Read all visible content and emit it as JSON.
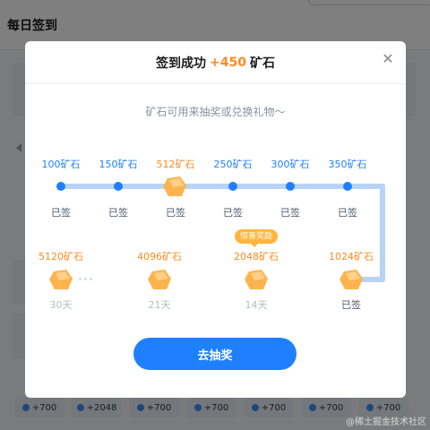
{
  "page": {
    "title": "每日签到",
    "watermark": "@稀土掘金技术社区",
    "reward_strip": [
      "+700",
      "+2048",
      "+700",
      "+700",
      "+700",
      "+700",
      "+700"
    ]
  },
  "modal": {
    "title_prefix": "签到成功",
    "title_amount": "+450",
    "title_suffix": "矿石",
    "subtitle": "矿石可用来抽奖或兑换礼物～",
    "close_icon": "close-icon",
    "button_label": "去抽奖",
    "badge": "惊喜奖励",
    "row1": [
      {
        "amount": "100矿石",
        "status": "已签",
        "highlight": false
      },
      {
        "amount": "150矿石",
        "status": "已签",
        "highlight": false
      },
      {
        "amount": "512矿石",
        "status": "已签",
        "highlight": true
      },
      {
        "amount": "250矿石",
        "status": "已签",
        "highlight": false
      },
      {
        "amount": "300矿石",
        "status": "已签",
        "highlight": false
      },
      {
        "amount": "350矿石",
        "status": "已签",
        "highlight": false
      }
    ],
    "row2": [
      {
        "amount": "5120矿石",
        "status": "30天"
      },
      {
        "amount": "4096矿石",
        "status": "21天"
      },
      {
        "amount": "2048矿石",
        "status": "14天"
      },
      {
        "amount": "1024矿石",
        "status": "已签"
      }
    ]
  },
  "colors": {
    "accent_blue": "#1e80ff",
    "accent_orange": "#ff8a1f",
    "badge": "#ffb53d"
  }
}
